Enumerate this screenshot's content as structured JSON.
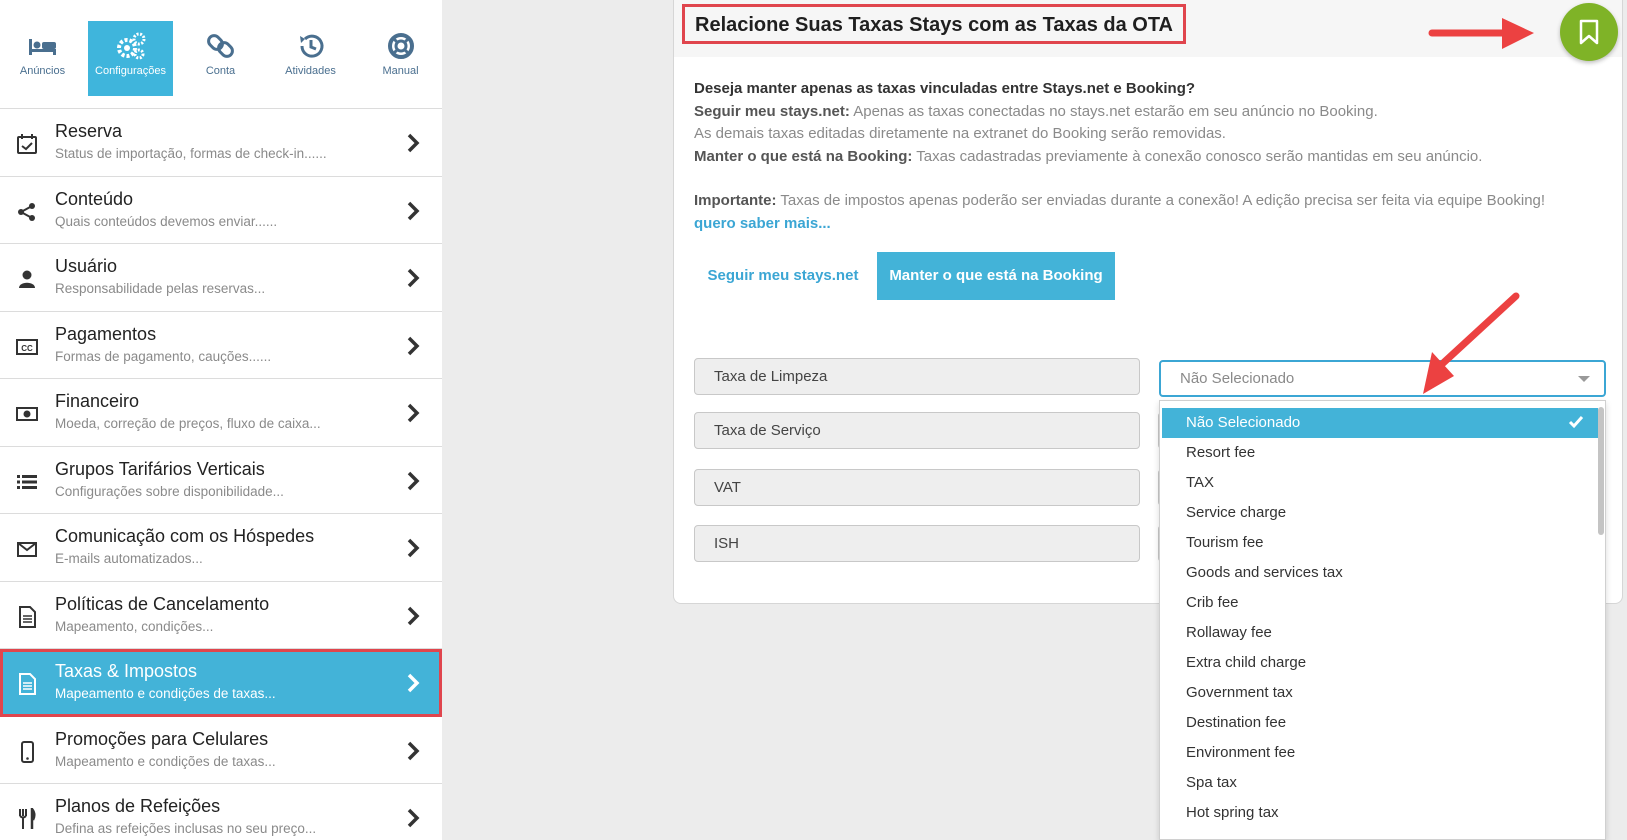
{
  "topnav": {
    "items": [
      {
        "label": "Anúncios",
        "icon": "bed-icon"
      },
      {
        "label": "Configurações",
        "icon": "gears-icon"
      },
      {
        "label": "Conta",
        "icon": "link-icon"
      },
      {
        "label": "Atividades",
        "icon": "history-icon"
      },
      {
        "label": "Manual",
        "icon": "lifebuoy-icon"
      }
    ],
    "active": "Configurações"
  },
  "sidebar": {
    "items": [
      {
        "title": "Reserva",
        "subtitle": "Status de importação, formas de check-in......",
        "icon": "calendar-check-icon"
      },
      {
        "title": "Conteúdo",
        "subtitle": "Quais conteúdos devemos enviar......",
        "icon": "share-icon"
      },
      {
        "title": "Usuário",
        "subtitle": "Responsabilidade pelas reservas...",
        "icon": "user-icon"
      },
      {
        "title": "Pagamentos",
        "subtitle": "Formas de pagamento, cauções......",
        "icon": "credit-card-icon"
      },
      {
        "title": "Financeiro",
        "subtitle": "Moeda, correção de preços, fluxo de caixa...",
        "icon": "money-icon"
      },
      {
        "title": "Grupos Tarifários Verticais",
        "subtitle": "Configurações sobre disponibilidade...",
        "icon": "list-icon"
      },
      {
        "title": "Comunicação com os Hóspedes",
        "subtitle": "E-mails automatizados...",
        "icon": "envelope-icon"
      },
      {
        "title": "Políticas de Cancelamento",
        "subtitle": "Mapeamento, condições...",
        "icon": "document-icon"
      },
      {
        "title": "Taxas & Impostos",
        "subtitle": "Mapeamento e condições de taxas...",
        "icon": "document-icon"
      },
      {
        "title": "Promoções para Celulares",
        "subtitle": "Mapeamento e condições de taxas...",
        "icon": "mobile-icon"
      },
      {
        "title": "Planos de Refeições",
        "subtitle": "Defina as refeições inclusas no seu preço...",
        "icon": "cutlery-icon"
      }
    ],
    "active": "Taxas & Impostos"
  },
  "main": {
    "title": "Relacione Suas Taxas Stays com as Taxas da OTA",
    "question": "Deseja manter apenas as taxas vinculadas entre Stays.net e Booking?",
    "follow_label": "Seguir meu stays.net:",
    "follow_text": " Apenas as taxas conectadas no stays.net estarão em seu anúncio no Booking.",
    "follow_text2": "As demais taxas editadas diretamente na extranet do Booking serão removidas.",
    "keep_label": "Manter o que está na Booking:",
    "keep_text": " Taxas cadastradas previamente à conexão conosco serão mantidas em seu anúncio.",
    "important_label": "Importante:",
    "important_text": " Taxas de impostos apenas poderão ser enviadas durante a conexão! A edição precisa ser feita via equipe Booking!",
    "more_link": "quero saber mais...",
    "tabs": {
      "follow": "Seguir meu stays.net",
      "keep": "Manter o que está na Booking",
      "active": "keep"
    },
    "fees": [
      "Taxa de Limpeza",
      "Taxa de Serviço",
      "VAT",
      "ISH"
    ],
    "select": {
      "value": "Não Selecionado",
      "options": [
        "Não Selecionado",
        "Resort fee",
        "TAX",
        "Service charge",
        "Tourism fee",
        "Goods and services tax",
        "Crib fee",
        "Rollaway fee",
        "Extra child charge",
        "Government tax",
        "Destination fee",
        "Environment fee",
        "Spa tax",
        "Hot spring tax"
      ]
    }
  },
  "colors": {
    "accent": "#43b3d8",
    "highlight": "#e0454d",
    "save": "#7fb327"
  }
}
